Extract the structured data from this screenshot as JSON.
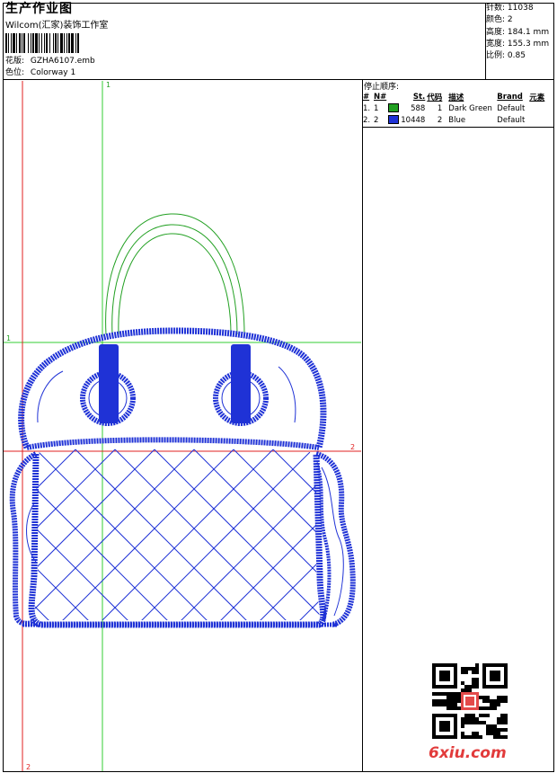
{
  "header": {
    "title": "生产作业图",
    "subtitle": "Wilcom(汇家)装饰工作室",
    "design_label": "花版:",
    "design_value": "GZHA6107.emb",
    "colorway_label": "色位:",
    "colorway_value": "Colorway 1"
  },
  "stats": {
    "stitches_label": "针数:",
    "stitches_value": "11038",
    "colors_label": "颜色:",
    "colors_value": "2",
    "height_label": "高度:",
    "height_value": "184.1 mm",
    "width_label": "宽度:",
    "width_value": "155.3 mm",
    "scale_label": "比例:",
    "scale_value": "0.85"
  },
  "stop_sequence": {
    "title": "停止顺序:",
    "headers": [
      "#",
      "N#",
      "",
      "St.",
      "代码",
      "描述",
      "Brand",
      "元素"
    ],
    "rows": [
      {
        "num": "1.",
        "n": "1",
        "color": "#22a022",
        "stitches": "588",
        "code": "1",
        "desc": "Dark Green",
        "brand": "Default",
        "elem": ""
      },
      {
        "num": "2.",
        "n": "2",
        "color": "#1f32d6",
        "stitches": "10448",
        "code": "2",
        "desc": "Blue",
        "brand": "Default",
        "elem": ""
      }
    ]
  },
  "guides": {
    "green_top": "1",
    "green_left": "1",
    "red_right": "2",
    "red_bottom": "2"
  },
  "logo": {
    "text": "6xiu.com"
  },
  "colors": {
    "green": "#22a022",
    "blue": "#1f32d6",
    "red": "#e02020",
    "guide_green": "#33cc33"
  }
}
